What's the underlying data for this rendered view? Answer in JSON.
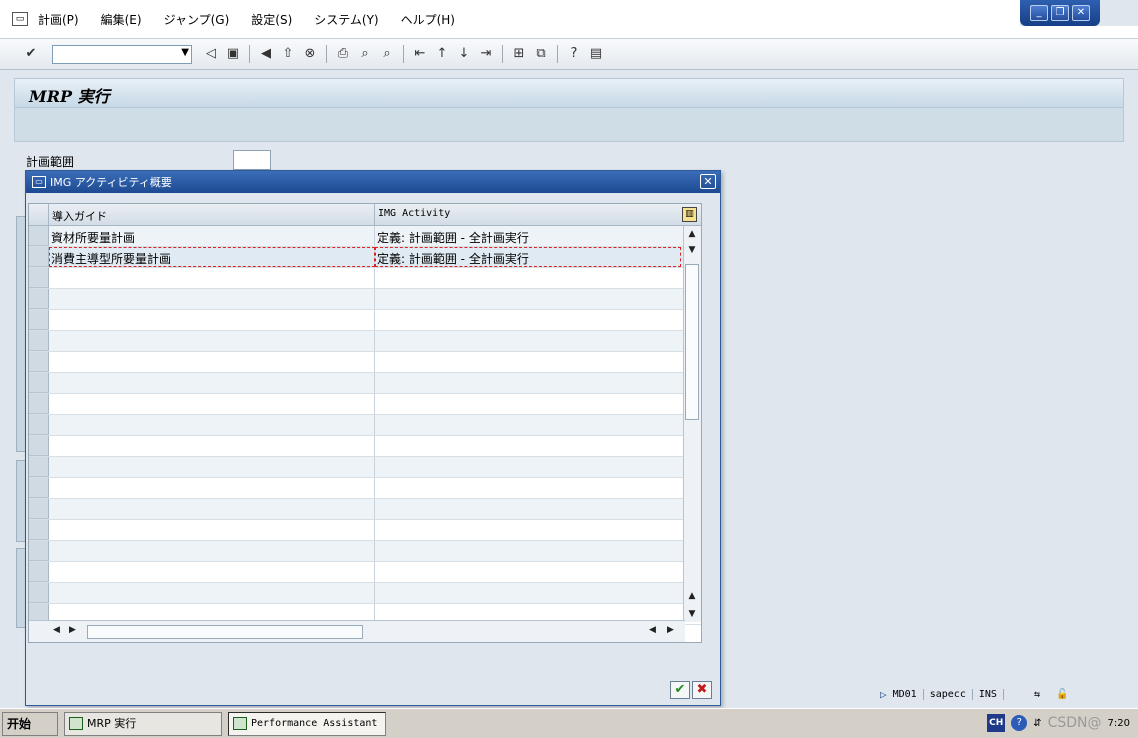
{
  "window": {
    "minimize_icon": "minimize-icon",
    "restore_icon": "restore-icon",
    "close_icon": "close-icon"
  },
  "menu": {
    "items": [
      "計画(P)",
      "編集(E)",
      "ジャンプ(G)",
      "設定(S)",
      "システム(Y)",
      "ヘルプ(H)"
    ]
  },
  "toolbar": {
    "command_field_value": "",
    "icons": [
      "check-icon",
      "back-icon",
      "save-icon",
      "exit-icon",
      "cancel-icon",
      "print-icon",
      "find-icon",
      "find-next-icon",
      "first-page-icon",
      "prev-page-icon",
      "next-page-icon",
      "last-page-icon",
      "new-session-icon",
      "shortcut-icon",
      "help-icon",
      "layout-icon"
    ]
  },
  "screen": {
    "title": "MRP 実行",
    "fields": {
      "plan_range_label": "計画範囲",
      "plan_range_value": ""
    }
  },
  "dialog": {
    "title": "IMG アクティビティ概要",
    "columns": [
      "導入ガイド",
      "IMG Activity"
    ],
    "rows": [
      {
        "guide": "資材所要量計画",
        "activity": "定義: 計画範囲 - 全計画実行"
      },
      {
        "guide": "消費主導型所要量計画",
        "activity": "定義: 計画範囲 - 全計画実行"
      }
    ],
    "empty_rows": 17,
    "buttons": {
      "ok": "✔",
      "cancel": "✖"
    }
  },
  "statusbar": {
    "transaction": "MD01",
    "server": "sapecc",
    "mode": "INS"
  },
  "taskbar": {
    "start_label": "开始",
    "tasks": [
      "MRP 実行",
      "Performance Assistant"
    ],
    "language": "CH",
    "time": "7:20",
    "watermark": "CSDN@"
  }
}
